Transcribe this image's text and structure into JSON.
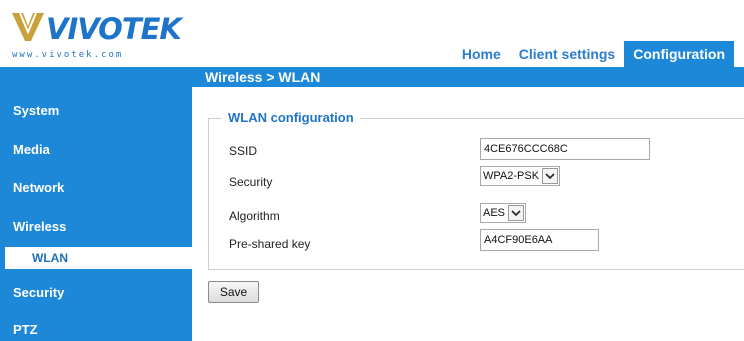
{
  "brand": {
    "name": "VIVOTEK",
    "url": "www.vivotek.com",
    "color": "#1e74c9"
  },
  "header": {
    "tabs": [
      {
        "label": "Home",
        "active": false
      },
      {
        "label": "Client settings",
        "active": false
      },
      {
        "label": "Configuration",
        "active": true
      }
    ]
  },
  "breadcrumb": "Wireless > WLAN",
  "sidebar": {
    "items": [
      {
        "label": "System"
      },
      {
        "label": "Media"
      },
      {
        "label": "Network"
      },
      {
        "label": "Wireless"
      },
      {
        "label": "WLAN"
      },
      {
        "label": "Security"
      },
      {
        "label": "PTZ"
      }
    ]
  },
  "wlan": {
    "title": "WLAN configuration",
    "ssid": {
      "label": "SSID",
      "value": "4CE676CCC68C"
    },
    "security": {
      "label": "Security",
      "value": "WPA2-PSK"
    },
    "algorithm": {
      "label": "Algorithm",
      "value": "AES"
    },
    "psk": {
      "label": "Pre-shared key",
      "value": "A4CF90E6AA"
    }
  },
  "actions": {
    "save_label": "Save"
  },
  "colors": {
    "accent": "#1e88d8",
    "sidebar_bg": "#1e88d8",
    "active_subitem_text": "#1e6fb8"
  }
}
